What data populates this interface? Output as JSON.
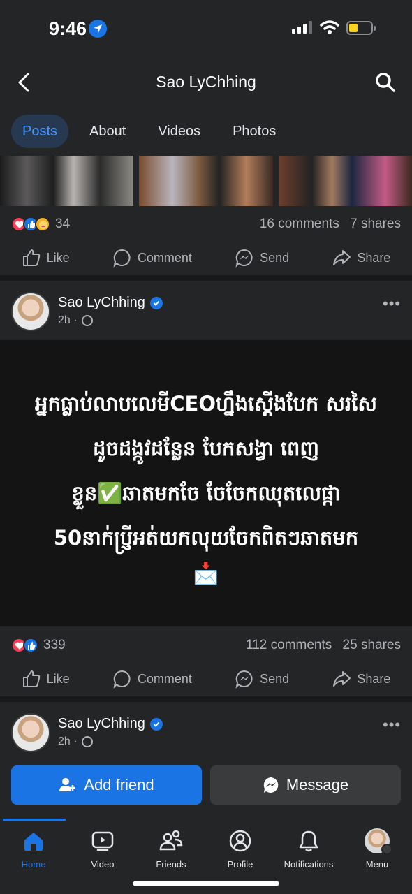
{
  "status_bar": {
    "time": "9:46"
  },
  "header": {
    "title": "Sao LyChhing"
  },
  "tabs": [
    {
      "label": "Posts",
      "active": true
    },
    {
      "label": "About",
      "active": false
    },
    {
      "label": "Videos",
      "active": false
    },
    {
      "label": "Photos",
      "active": false
    }
  ],
  "post1": {
    "reaction_count": "34",
    "comments": "16 comments",
    "shares": "7 shares",
    "reactions": [
      "love-icon",
      "like-icon",
      "care-icon"
    ]
  },
  "actions": {
    "like": "Like",
    "comment": "Comment",
    "send": "Send",
    "share": "Share"
  },
  "post2": {
    "author": "Sao LyChhing",
    "time": "2h ·",
    "text": "អ្នកធ្លាប់លាបលេមីCEOហ្នឹងស្តើងបែក សរសៃ ដូចដង្កូវដន្លែន  បែកសង្វា ពេញ ខ្លួន✅ឆាតមកចែ ចែចែកឈុតលេផ្កា 50នាក់ប្រ្ញីអត់យកលុយចែកពិតៗឆាតមក",
    "emoji": "📩",
    "reaction_count": "339",
    "comments": "112 comments",
    "shares": "25 shares"
  },
  "post3": {
    "author": "Sao LyChhing",
    "time": "2h ·",
    "add_friend": "Add friend",
    "message": "Message"
  },
  "tabbar": {
    "home": "Home",
    "video": "Video",
    "friends": "Friends",
    "profile": "Profile",
    "notifications": "Notifications",
    "menu": "Menu"
  },
  "colors": {
    "accent": "#1b74e4",
    "background": "#242526",
    "divider": "#18191a"
  }
}
